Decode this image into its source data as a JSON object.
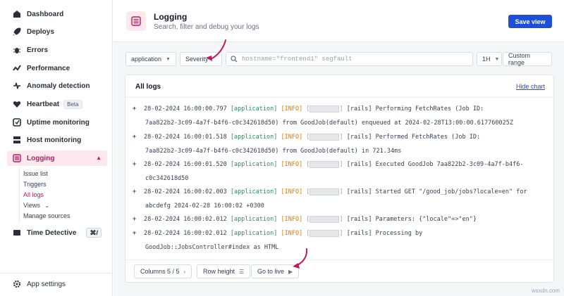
{
  "sidebar": {
    "items": [
      {
        "label": "Dashboard",
        "icon": "dashboard-icon"
      },
      {
        "label": "Deploys",
        "icon": "rocket-icon"
      },
      {
        "label": "Errors",
        "icon": "bug-icon"
      },
      {
        "label": "Performance",
        "icon": "performance-icon"
      },
      {
        "label": "Anomaly detection",
        "icon": "anomaly-icon"
      },
      {
        "label": "Heartbeat",
        "icon": "heart-icon",
        "badge": "Beta"
      },
      {
        "label": "Uptime monitoring",
        "icon": "uptime-icon"
      },
      {
        "label": "Host monitoring",
        "icon": "host-icon"
      },
      {
        "label": "Logging",
        "icon": "logging-icon",
        "active": true
      },
      {
        "label": "Time Detective",
        "icon": "time-detective-icon",
        "shortcut": "⌘/"
      }
    ],
    "logging_sub": [
      {
        "label": "Issue list"
      },
      {
        "label": "Triggers"
      },
      {
        "label": "All logs",
        "active": true
      },
      {
        "label": "Views"
      },
      {
        "label": "Manage sources"
      }
    ],
    "app_settings": "App settings"
  },
  "header": {
    "title": "Logging",
    "subtitle": "Search, filter and debug your logs",
    "save_label": "Save view"
  },
  "toolbar": {
    "source": "application",
    "severity": "Severity",
    "search_placeholder": "hostname=\"frontend1\" segfault",
    "range": "1H",
    "custom_range": "Custom range"
  },
  "panel": {
    "title": "All logs",
    "hide_chart": "Hide chart"
  },
  "logs": [
    {
      "ts": "28-02-2024 16:00:00.797",
      "src": "[application]",
      "lvl": "[INFO]",
      "tag": "[rails]",
      "line1": "Performing FetchRates (Job ID:",
      "line2": "7aa822b2-3c09-4a7f-b4f6-c0c342618d50) from GoodJob(default) enqueued at 2024-02-28T13:00:00.617760025Z"
    },
    {
      "ts": "28-02-2024 16:00:01.518",
      "src": "[application]",
      "lvl": "[INFO]",
      "tag": "[rails]",
      "line1": "Performed FetchRates (Job ID:",
      "line2": "7aa822b2-3c09-4a7f-b4f6-c0c342618d50) from GoodJob(default) in 721.34ms"
    },
    {
      "ts": "28-02-2024 16:00:01.520",
      "src": "[application]",
      "lvl": "[INFO]",
      "tag": "[rails]",
      "line1": "Executed GoodJob 7aa822b2-3c09-4a7f-b4f6-",
      "line2": "c0c342618d50"
    },
    {
      "ts": "28-02-2024 16:00:02.003",
      "src": "[application]",
      "lvl": "[INFO]",
      "tag": "[rails]",
      "line1": "Started GET \"/good_job/jobs?locale=en\" for",
      "line2": "abcdefg 2024-02-28 16:00:02 +0300"
    },
    {
      "ts": "28-02-2024 16:00:02.012",
      "src": "[application]",
      "lvl": "[INFO]",
      "tag": "[rails]",
      "line1": "Parameters: {\"locale\"=>\"en\"}",
      "line2": ""
    },
    {
      "ts": "28-02-2024 16:00:02.012",
      "src": "[application]",
      "lvl": "[INFO]",
      "tag": "[rails]",
      "line1": "Processing by",
      "line2": "GoodJob::JobsController#index as HTML"
    }
  ],
  "footer": {
    "columns": "Columns 5 / 5",
    "row_height": "Row height",
    "go_live": "Go to live"
  },
  "watermark": "wsxdn.com",
  "colors": {
    "accent": "#c2185b",
    "primary_button": "#1f4fd8",
    "source_green": "#2e8b57",
    "info_orange": "#d97706",
    "arrow": "#c2185b"
  }
}
